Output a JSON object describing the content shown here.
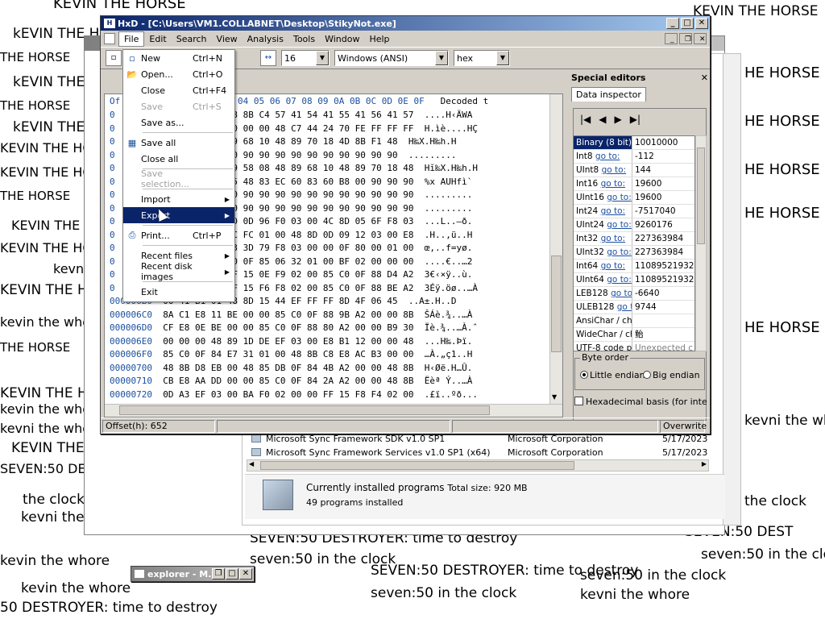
{
  "background_text": [
    "KEVIN THE HORSE",
    "kEVIN THE HORSE",
    "THE HORSE",
    "SEVEN:50 DESTROYER: time to destroy",
    "seven:50 in the clock",
    "kevni the whore",
    "kevin the whore",
    "50 DESTROYER: time to destroy",
    "HE HORSE",
    "SEVEN:50 DEST",
    "seven:50 in the clock",
    "the clock",
    "kevni the whore"
  ],
  "hxd": {
    "title": "HxD - [C:\\Users\\VM1.COLLABNET\\Desktop\\StikyNot.exe]",
    "menu": [
      "File",
      "Edit",
      "Search",
      "View",
      "Analysis",
      "Tools",
      "Window",
      "Help"
    ],
    "bytes_per_row": "16",
    "charset": "Windows (ANSI)",
    "offset_base": "hex",
    "header_offset": "Of",
    "header_cols": "03 04 05 06 07 08 09 0A 0B 0C 0D 0E 0F",
    "header_decoded": "Decoded t",
    "rows": [
      {
        "off": "0",
        "hex": "90 48 8B C4 57 41 54 41 55 41 56 41 57",
        "dec": "....H‹ÄWA"
      },
      {
        "off": "0",
        "hex": "80 00 00 00 48 C7 44 24 70 FE FF FF FF",
        "dec": "H.ìè....HÇ"
      },
      {
        "off": "0",
        "hex": "48 89 68 10 48 89 70 18 4D 8B F1 48",
        "dec": "H‰X.H‰h.H"
      },
      {
        "off": "0",
        "hex": "90 90 90 90 90 90 90 90 90 90 90 90",
        "dec": "........."
      },
      {
        "off": "0",
        "hex": "48 89 58 08 48 89 68 10 48 89 70 18 48",
        "dec": "Hĭ‰X.H‰h.H"
      },
      {
        "off": "0",
        "hex": "41 55 48 83 EC 60 83 60 B8 00 90 90 90",
        "dec": "%x AUHfì`"
      },
      {
        "off": "0",
        "hex": "90 90 90 90 90 90 90 90 90 90 90 90 90",
        "dec": "........."
      },
      {
        "off": "0",
        "hex": "90 90 90 90 90 90 90 90 90 90 90 90 90",
        "dec": "........."
      },
      {
        "off": "0",
        "hex": "4C 8D 0D 96 F0 03 00 4C 8D 05 6F F8 03",
        "dec": "...L..–ð."
      },
      {
        "off": "0",
        "hex": "15 2C FC 01 00 48 8D 0D 09 12 03 00 E8",
        "dec": ".H..,ü..H"
      },
      {
        "off": "0",
        "hex": "80 83 3D 79 F8 03 00 00 0F 80 00 01 00",
        "dec": "œ,..f=yø."
      },
      {
        "off": "0",
        "hex": "01 80 0F 85 06 32 01 00 BF 02 00 00 00",
        "dec": "....€..…2"
      },
      {
        "off": "0",
        "hex": "D7 FF 15 0E F9 02 00 85 C0 0F 88 D4 A2",
        "dec": "3€‹×ÿ..ù."
      },
      {
        "off": "0",
        "hex": "C9 FF 15 F6 F8 02 00 85 C0 0F 88 BE A2",
        "dec": "3Éÿ.öø..…À"
      },
      {
        "off": "000006B0",
        "hex": "00 41 B1 01 48 8D 15 44 EF FF FF 8D 4F 06 45",
        "dec": "..A±.H..D"
      },
      {
        "off": "000006C0",
        "hex": "8A C1 E8 11 BE 00 00 85 C0 0F 88 9B A2 00 00 8B",
        "dec": "ŠÁè.¾..…À"
      },
      {
        "off": "000006D0",
        "hex": "CF E8 0E BE 00 00 85 C0 0F 88 80 A2 00 00 B9 30",
        "dec": "Ïè.¾..…À.ˆ"
      },
      {
        "off": "000006E0",
        "hex": "00 00 00 48 89 1D DE EF 03 00 E8 B1 12 00 00 48",
        "dec": "...H‰.Þï."
      },
      {
        "off": "000006F0",
        "hex": "85 C0 0F 84 E7 31 01 00 48 8B C8 E8 AC B3 00 00",
        "dec": "…À.„ç1..H"
      },
      {
        "off": "00000700",
        "hex": "48 8B D8 EB 00 48 85 DB 0F 84 4B A2 00 00 48 8B",
        "dec": "H‹Øë.H…Û."
      },
      {
        "off": "00000710",
        "hex": "CB E8 AA DD 00 00 85 C0 0F 84 2A A2 00 00 48 8B",
        "dec": "Ëèª Ý..…À"
      },
      {
        "off": "00000720",
        "hex": "0D A3 EF 03 00 BA F0 02 00 00 FF 15 F8 F4 02 00",
        "dec": ".£ï..ºð..."
      }
    ],
    "status_offset": "Offset(h): 652",
    "status_mode": "Overwrite",
    "file_menu": [
      {
        "label": "New",
        "shortcut": "Ctrl+N",
        "icon": "new-file-icon",
        "enabled": true
      },
      {
        "label": "Open...",
        "shortcut": "Ctrl+O",
        "icon": "open-folder-icon",
        "enabled": true
      },
      {
        "label": "Close",
        "shortcut": "Ctrl+F4",
        "icon": "",
        "enabled": true
      },
      {
        "label": "Save",
        "shortcut": "Ctrl+S",
        "icon": "",
        "enabled": false
      },
      {
        "label": "Save as...",
        "shortcut": "",
        "icon": "",
        "enabled": true
      },
      {
        "label": "Save all",
        "shortcut": "",
        "icon": "save-all-icon",
        "enabled": true
      },
      {
        "label": "Close all",
        "shortcut": "",
        "icon": "",
        "enabled": true
      },
      {
        "label": "Save selection...",
        "shortcut": "",
        "icon": "",
        "enabled": false
      },
      {
        "label": "Import",
        "shortcut": "",
        "icon": "",
        "enabled": true,
        "submenu": true
      },
      {
        "label": "Export",
        "shortcut": "",
        "icon": "",
        "enabled": true,
        "submenu": true,
        "highlighted": true
      },
      {
        "label": "Print...",
        "shortcut": "Ctrl+P",
        "icon": "printer-icon",
        "enabled": true
      },
      {
        "label": "Recent files",
        "shortcut": "",
        "icon": "",
        "enabled": true,
        "submenu": true
      },
      {
        "label": "Recent disk images",
        "shortcut": "",
        "icon": "",
        "enabled": true,
        "submenu": true
      },
      {
        "label": "Exit",
        "shortcut": "",
        "icon": "",
        "enabled": true
      }
    ],
    "special_editors": {
      "title": "Special editors",
      "tab": "Data inspector",
      "goto": "go to:",
      "rows": [
        {
          "name": "Binary (8 bit)",
          "value": "10010000",
          "goto": false,
          "selected": true
        },
        {
          "name": "Int8",
          "value": "-112",
          "goto": true
        },
        {
          "name": "UInt8",
          "value": "144",
          "goto": true
        },
        {
          "name": "Int16",
          "value": "19600",
          "goto": true
        },
        {
          "name": "UInt16",
          "value": "19600",
          "goto": true
        },
        {
          "name": "Int24",
          "value": "-7517040",
          "goto": true
        },
        {
          "name": "UInt24",
          "value": "9260176",
          "goto": true
        },
        {
          "name": "Int32",
          "value": "227363984",
          "goto": true
        },
        {
          "name": "UInt32",
          "value": "227363984",
          "goto": true
        },
        {
          "name": "Int64",
          "value": "11089521932",
          "goto": true
        },
        {
          "name": "UInt64",
          "value": "11089521932",
          "goto": true
        },
        {
          "name": "LEB128",
          "value": "-6640",
          "goto": true
        },
        {
          "name": "ULEB128",
          "value": "9744",
          "goto": true
        },
        {
          "name": "AnsiChar / cha",
          "value": "",
          "goto": false
        },
        {
          "name": "WideChar / ch",
          "value": "鲐",
          "goto": false
        },
        {
          "name": "UTF-8 code po",
          "value": "Unexpected c",
          "goto": false
        }
      ],
      "byte_order_label": "Byte order",
      "little_endian": "Little endian",
      "big_endian": "Big endian",
      "hex_basis": "Hexadecimal basis (for integra"
    }
  },
  "programs": {
    "items": [
      {
        "name": "Microsoft Sync Framework SDK v1.0 SP1",
        "publisher": "Microsoft Corporation",
        "date": "5/17/2023"
      },
      {
        "name": "Microsoft Sync Framework Services v1.0 SP1 (x64)",
        "publisher": "Microsoft Corporation",
        "date": "5/17/2023"
      }
    ],
    "summary_title": "Currently installed programs",
    "total_size": "Total size: 920 MB",
    "count": "49 programs installed"
  },
  "taskbar_mini": {
    "title": "explorer - M..."
  },
  "colors": {
    "titlebar": "#0a246a",
    "highlight": "#0a246a",
    "offset_blue": "#1a4fa0"
  }
}
